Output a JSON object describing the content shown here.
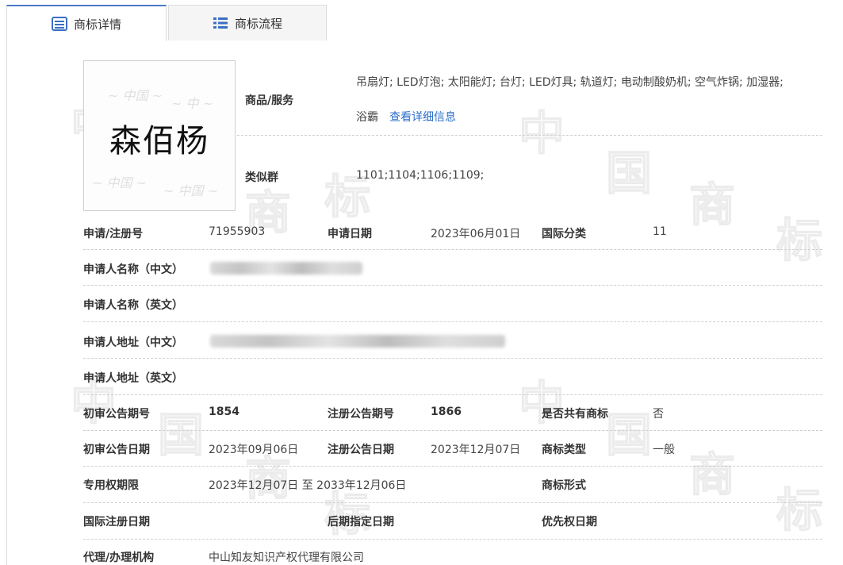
{
  "tabs": [
    {
      "label": "商标详情",
      "active": true
    },
    {
      "label": "商标流程",
      "active": false
    }
  ],
  "watermark": {
    "chars": [
      "中",
      "国",
      "商",
      "标"
    ]
  },
  "logo": {
    "text": "森佰杨"
  },
  "goods": {
    "label": "商品/服务",
    "value_line1": "吊扇灯; LED灯泡; 太阳能灯; 台灯; LED灯具; 轨道灯; 电动制酸奶机; 空气炸锅; 加湿器;",
    "value_line2": "浴霸",
    "link": "查看详细信息"
  },
  "similar_group": {
    "label": "类似群",
    "value": "1101;1104;1106;1109;"
  },
  "fields": {
    "reg_no": {
      "label": "申请/注册号",
      "value": "71955903"
    },
    "apply_date": {
      "label": "申请日期",
      "value": "2023年06月01日"
    },
    "intl_class": {
      "label": "国际分类",
      "value": "11"
    },
    "applicant_cn": {
      "label": "申请人名称（中文）"
    },
    "applicant_en": {
      "label": "申请人名称（英文）"
    },
    "address_cn": {
      "label": "申请人地址（中文）"
    },
    "address_en": {
      "label": "申请人地址（英文）"
    },
    "prelim_no": {
      "label": "初审公告期号",
      "value": "1854"
    },
    "reg_notice_no": {
      "label": "注册公告期号",
      "value": "1866"
    },
    "shared": {
      "label": "是否共有商标",
      "value": "否"
    },
    "prelim_date": {
      "label": "初审公告日期",
      "value": "2023年09月06日"
    },
    "reg_notice_date": {
      "label": "注册公告日期",
      "value": "2023年12月07日"
    },
    "tm_type": {
      "label": "商标类型",
      "value": "一般"
    },
    "exclusive_period": {
      "label": "专用权期限",
      "value": "2023年12月07日 至 2033年12月06日"
    },
    "tm_form": {
      "label": "商标形式",
      "value": ""
    },
    "intl_reg_date": {
      "label": "国际注册日期",
      "value": ""
    },
    "later_designation": {
      "label": "后期指定日期",
      "value": ""
    },
    "priority_date": {
      "label": "优先权日期",
      "value": ""
    },
    "agent": {
      "label": "代理/办理机构",
      "value": "中山知友知识产权代理有限公司"
    }
  }
}
